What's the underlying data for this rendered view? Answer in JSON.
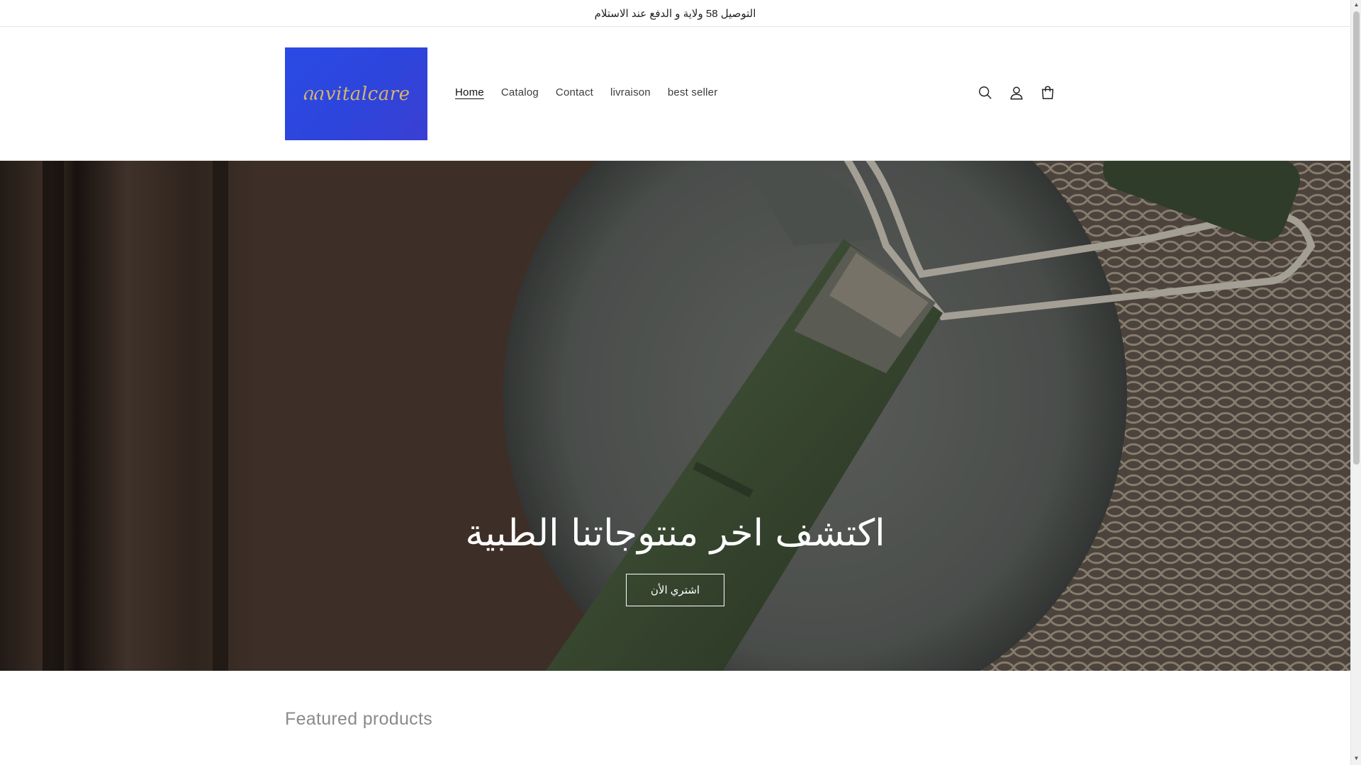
{
  "announcement": {
    "text": "التوصيل 58 ولاية و الدفع عند الاستلام"
  },
  "header": {
    "logo_text": "vitalcare",
    "nav": [
      {
        "label": "Home",
        "active": true
      },
      {
        "label": "Catalog",
        "active": false
      },
      {
        "label": "Contact",
        "active": false
      },
      {
        "label": "livraison",
        "active": false
      },
      {
        "label": "best seller",
        "active": false
      }
    ],
    "icons": [
      "search-icon",
      "account-icon",
      "cart-icon"
    ]
  },
  "hero": {
    "title": "اكتشف اخر منتوجاتنا الطبية",
    "button_label": "اشتري الأن"
  },
  "featured": {
    "title": "Featured products"
  },
  "colors": {
    "logo_bg": "#2b4be6",
    "logo_text": "#d8b46a",
    "text": "#121212",
    "muted": "#8a8a8a"
  }
}
